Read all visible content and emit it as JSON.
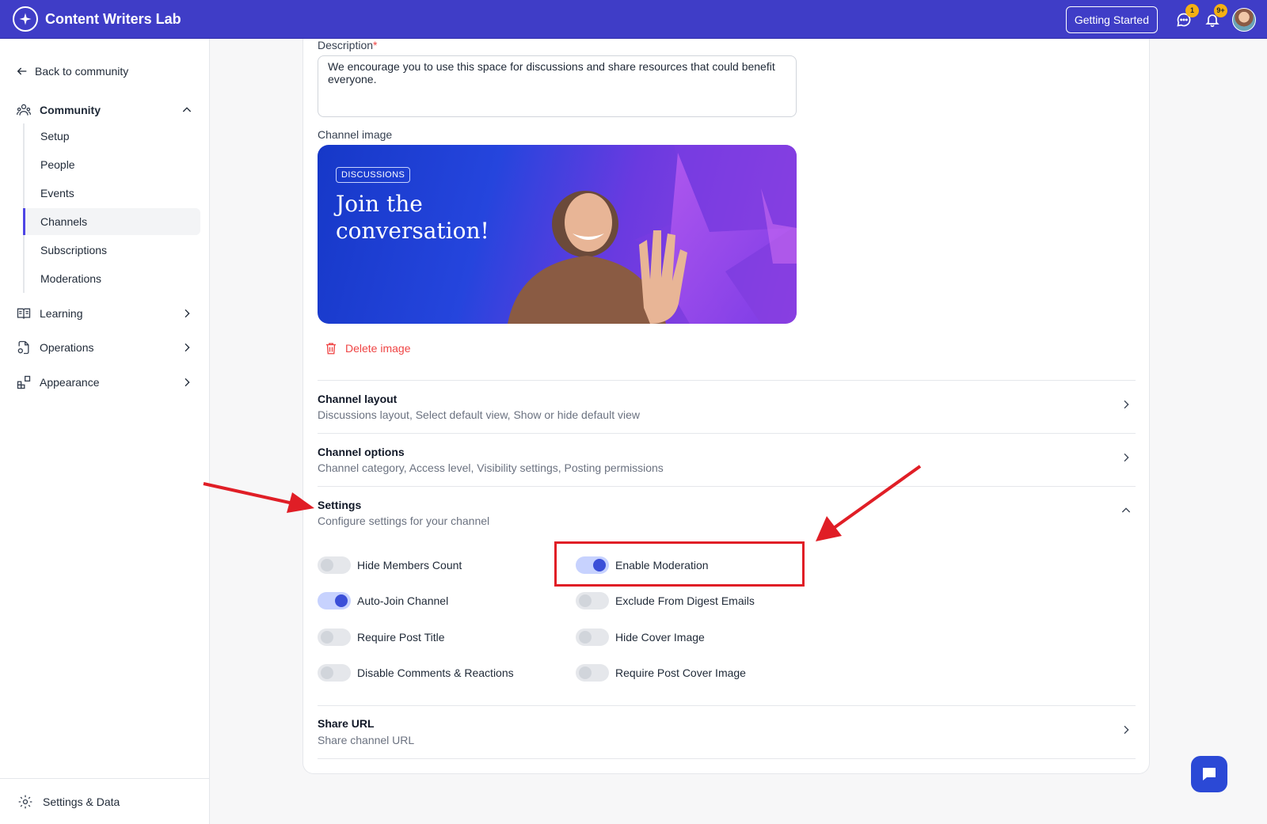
{
  "app": {
    "name": "Content Writers Lab"
  },
  "topbar": {
    "getting_started_label": "Getting Started",
    "messages_badge": "1",
    "notifications_badge": "9+"
  },
  "sidebar": {
    "back_label": "Back to community",
    "community": {
      "label": "Community",
      "items": [
        "Setup",
        "People",
        "Events",
        "Channels",
        "Subscriptions",
        "Moderations"
      ],
      "active": "Channels"
    },
    "sections": [
      {
        "label": "Learning"
      },
      {
        "label": "Operations"
      },
      {
        "label": "Appearance"
      }
    ],
    "footer_label": "Settings & Data"
  },
  "form": {
    "description_label": "Description",
    "description_required_mark": "*",
    "description_value": "We encourage you to use this space for discussions and share resources that could benefit everyone.",
    "channel_image_label": "Channel image",
    "banner_tag": "DISCUSSIONS",
    "banner_title": "Join the conversation!",
    "delete_image_label": "Delete image"
  },
  "sections": {
    "layout": {
      "title": "Channel layout",
      "subtitle": "Discussions layout, Select default view, Show or hide default view"
    },
    "options": {
      "title": "Channel options",
      "subtitle": "Channel category, Access level, Visibility settings, Posting permissions"
    },
    "settings": {
      "title": "Settings",
      "subtitle": "Configure settings for your channel"
    },
    "share": {
      "title": "Share URL",
      "subtitle": "Share channel URL"
    }
  },
  "toggles": [
    {
      "label": "Hide Members Count",
      "on": false
    },
    {
      "label": "Enable Moderation",
      "on": true
    },
    {
      "label": "Auto-Join Channel",
      "on": true
    },
    {
      "label": "Exclude From Digest Emails",
      "on": false
    },
    {
      "label": "Require Post Title",
      "on": false
    },
    {
      "label": "Hide Cover Image",
      "on": false
    },
    {
      "label": "Disable Comments & Reactions",
      "on": false
    },
    {
      "label": "Require Post Cover Image",
      "on": false
    }
  ],
  "colors": {
    "topbar": "#3f3dc7",
    "accent": "#3b4fd8",
    "annotation": "#e01e26",
    "danger": "#ef4444"
  }
}
